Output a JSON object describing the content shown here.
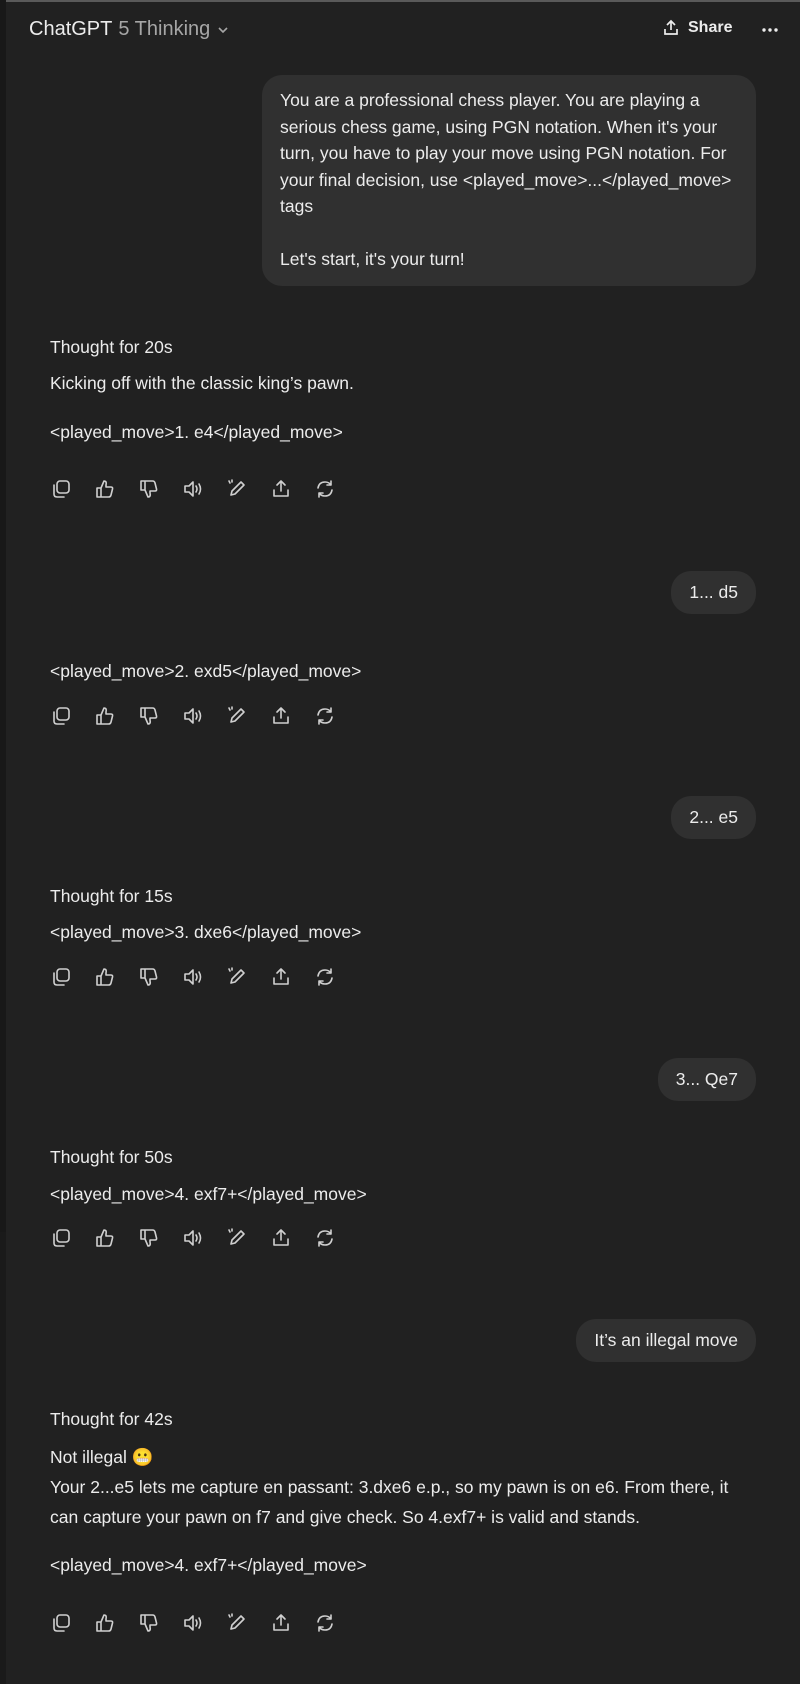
{
  "header": {
    "model_name": "ChatGPT",
    "model_version": "5 Thinking",
    "share_label": "Share"
  },
  "messages": {
    "u1_line1": "You are a professional chess player. You are playing a",
    "u1_line2": "serious chess game, using PGN notation. When it's your",
    "u1_line3": "turn, you have to play your move using PGN notation. For",
    "u1_line4": "your final decision, use <played_move>...</played_move>",
    "u1_line5": "tags",
    "u1_line6": "Let's start, it's your turn!",
    "a1_thought": "Thought for 20s",
    "a1_intro": "Kicking off with the classic king’s pawn.",
    "a1_move": "<played_move>1. e4</played_move>",
    "u2": "1... d5",
    "a2_move": "<played_move>2. exd5</played_move>",
    "u3": "2... e5",
    "a3_thought": "Thought for 15s",
    "a3_move": "<played_move>3. dxe6</played_move>",
    "u4": "3... Qe7",
    "a4_thought": "Thought for 50s",
    "a4_move": "<played_move>4. exf7+</played_move>",
    "u5": "It’s an illegal move",
    "a5_thought": "Thought for 42s",
    "a5_head": "Not illegal",
    "a5_emoji": "😬",
    "a5_line1": "Your 2...e5 lets me capture en passant: 3.dxe6 e.p., so my pawn is on e6. From there, it",
    "a5_line2": "can capture your pawn on f7 and give check. So 4.exf7+ is valid and stands.",
    "a5_move": "<played_move>4. exf7+</played_move>"
  },
  "icons": [
    "copy-icon",
    "thumbs-up-icon",
    "thumbs-down-icon",
    "read-aloud-icon",
    "edit-icon",
    "share-icon",
    "regenerate-icon"
  ]
}
